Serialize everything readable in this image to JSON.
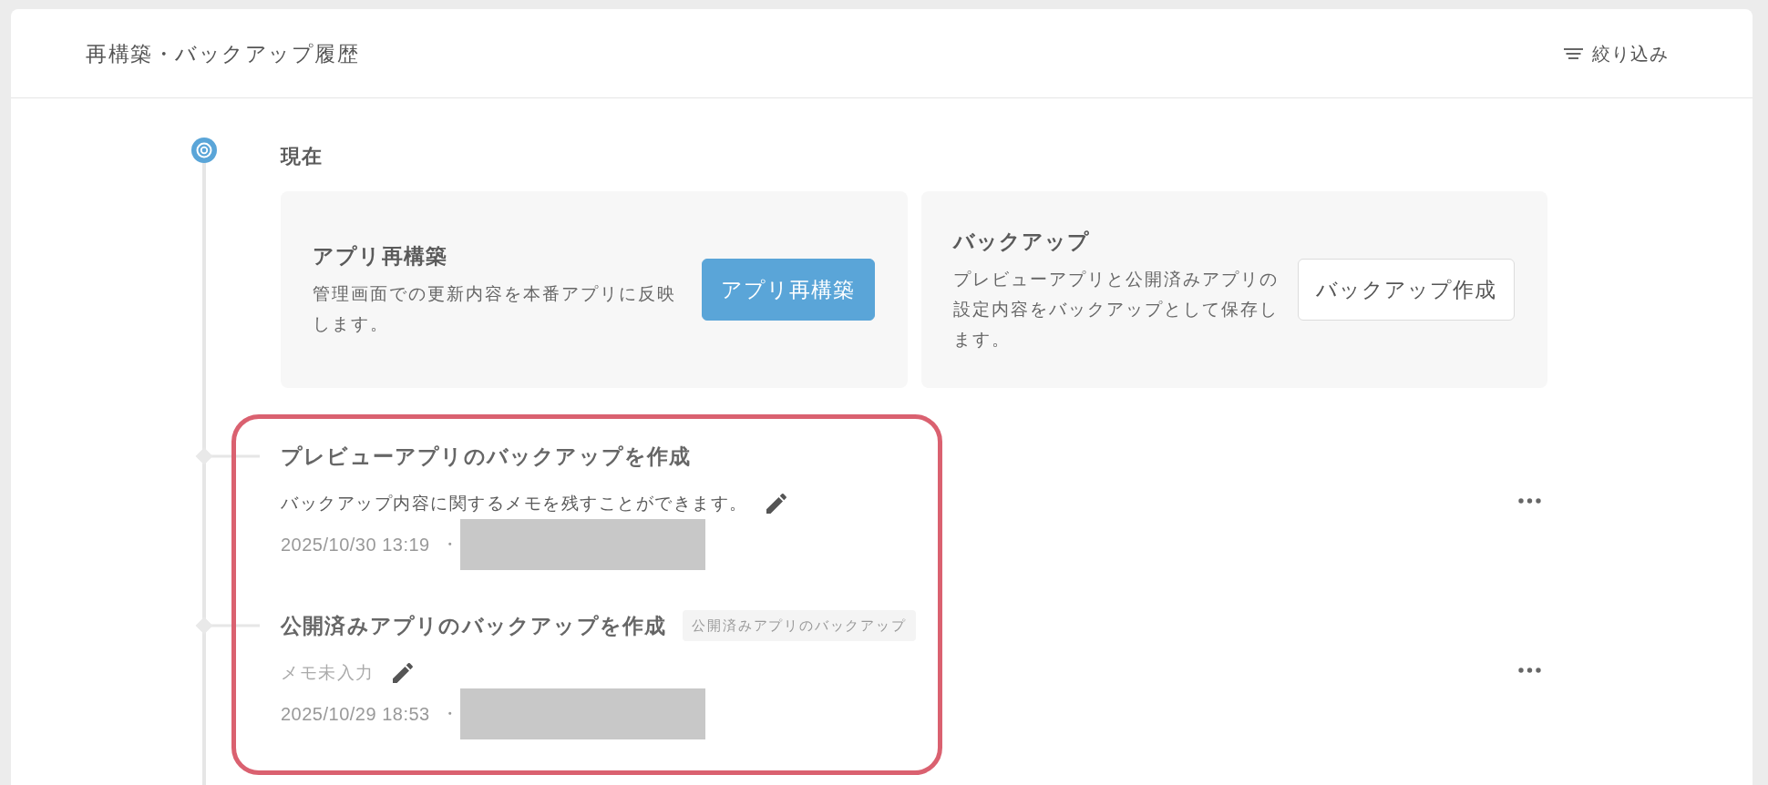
{
  "header": {
    "title": "再構築・バックアップ履歴",
    "filter_button": "絞り込み"
  },
  "timeline": {
    "current": {
      "label": "現在",
      "cards": [
        {
          "title": "アプリ再構築",
          "description": "管理画面での更新内容を本番アプリに反映します。",
          "button": {
            "label": "アプリ再構築",
            "kind": "primary"
          }
        },
        {
          "title": "バックアップ",
          "description": "プレビューアプリと公開済みアプリの設定内容をバックアップとして保存します。",
          "button": {
            "label": "バックアップ作成",
            "kind": "secondary"
          }
        }
      ]
    },
    "highlight_frame": true,
    "entries": [
      {
        "title": "プレビューアプリのバックアップを作成",
        "memo": "バックアップ内容に関するメモを残すことができます。",
        "memo_filled": true,
        "date": "2025/10/30 13:19",
        "separator": "・"
      },
      {
        "title": "公開済みアプリのバックアップを作成",
        "tag": "公開済みアプリのバックアップ",
        "memo": "メモ未入力",
        "memo_filled": false,
        "date": "2025/10/29 18:53",
        "separator": "・"
      }
    ]
  }
}
